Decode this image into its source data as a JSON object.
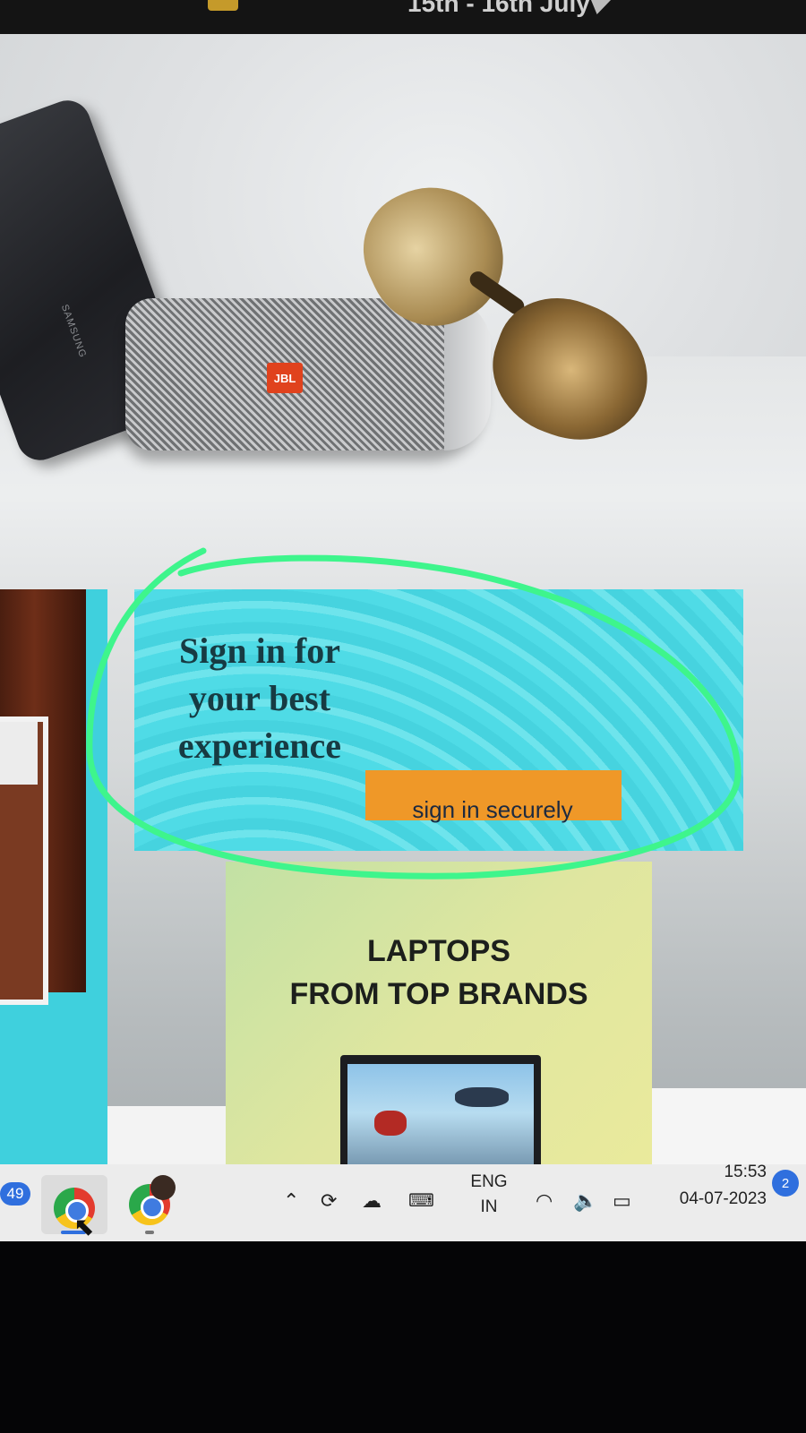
{
  "topbar": {
    "promo_text": "15th - 16th July"
  },
  "hero": {
    "phone_brand": "SAMSUNG",
    "speaker_logo": "JBL"
  },
  "signin_card": {
    "title": "Sign in for your best experience",
    "button_label": "sign in securely"
  },
  "laptop_card": {
    "title_line1": "LAPTOPS",
    "title_line2": "FROM TOP BRANDS"
  },
  "annotation": {
    "ring_color": "#3ef58c"
  },
  "taskbar": {
    "left_badge": "49",
    "language_line1": "ENG",
    "language_line2": "IN",
    "time": "15:53",
    "date": "04-07-2023",
    "notification_count": "2"
  },
  "colors": {
    "accent_cyan": "#46d3df",
    "button_orange": "#ef9828",
    "laptop_card": "#dfe6a0"
  }
}
